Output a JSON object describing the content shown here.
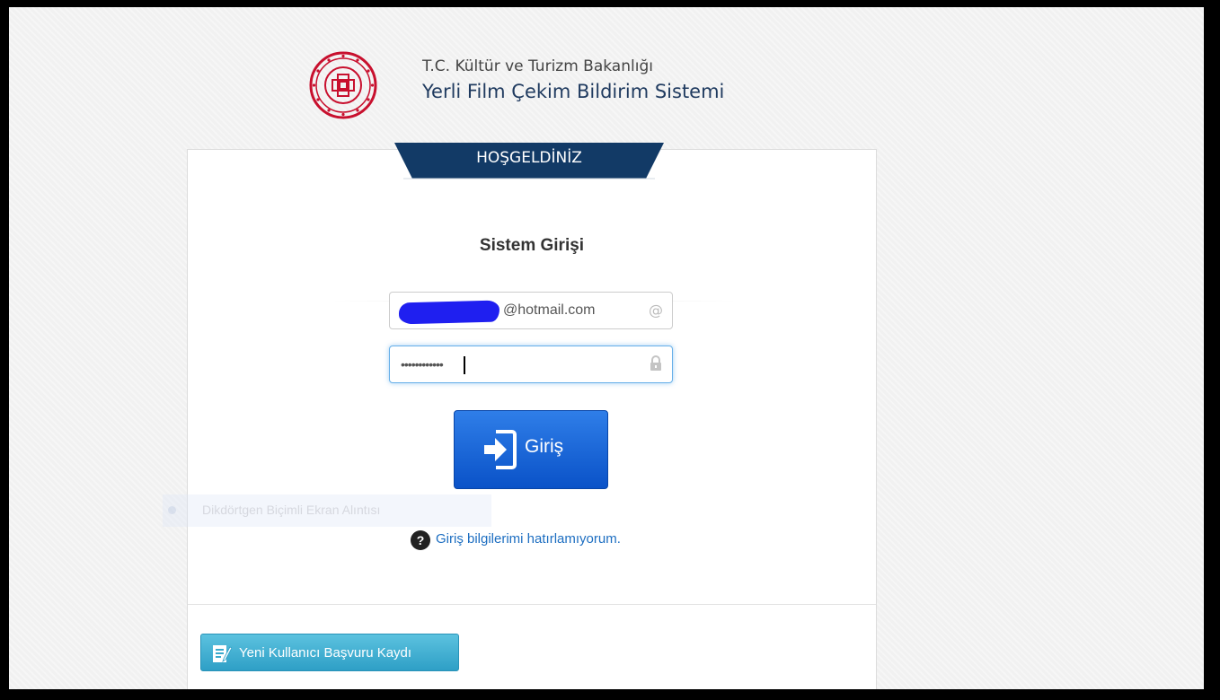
{
  "header": {
    "ministry": "T.C. Kültür ve Turizm Bakanlığı",
    "system_name": "Yerli Film Çekim Bildirim Sistemi",
    "emblem_icon": "ministry-emblem-icon"
  },
  "card": {
    "welcome_tab": "HOŞGELDİNİZ",
    "login_title": "Sistem Girişi",
    "email": {
      "value": "@hotmail.com",
      "redacted": true,
      "icon": "at-icon",
      "icon_glyph": "@"
    },
    "password": {
      "value": "••••••••••••",
      "icon": "lock-icon",
      "focused": true
    },
    "login_button": {
      "label": "Giriş",
      "icon": "sign-in-icon"
    },
    "ghost_overlay": "Dikdörtgen Biçimli Ekran Alıntısı",
    "help": {
      "icon_glyph": "?",
      "icon": "question-icon",
      "label": "Giriş bilgilerimi hatırlamıyorum."
    },
    "register_button": {
      "label": "Yeni Kullanıcı Başvuru Kaydı",
      "icon": "edit-form-icon"
    }
  },
  "colors": {
    "accent_navy": "#123a66",
    "login_blue": "#0a52c8",
    "register_teal": "#2e9fc6",
    "emblem_red": "#c8102e",
    "link": "#1d6ec1"
  }
}
